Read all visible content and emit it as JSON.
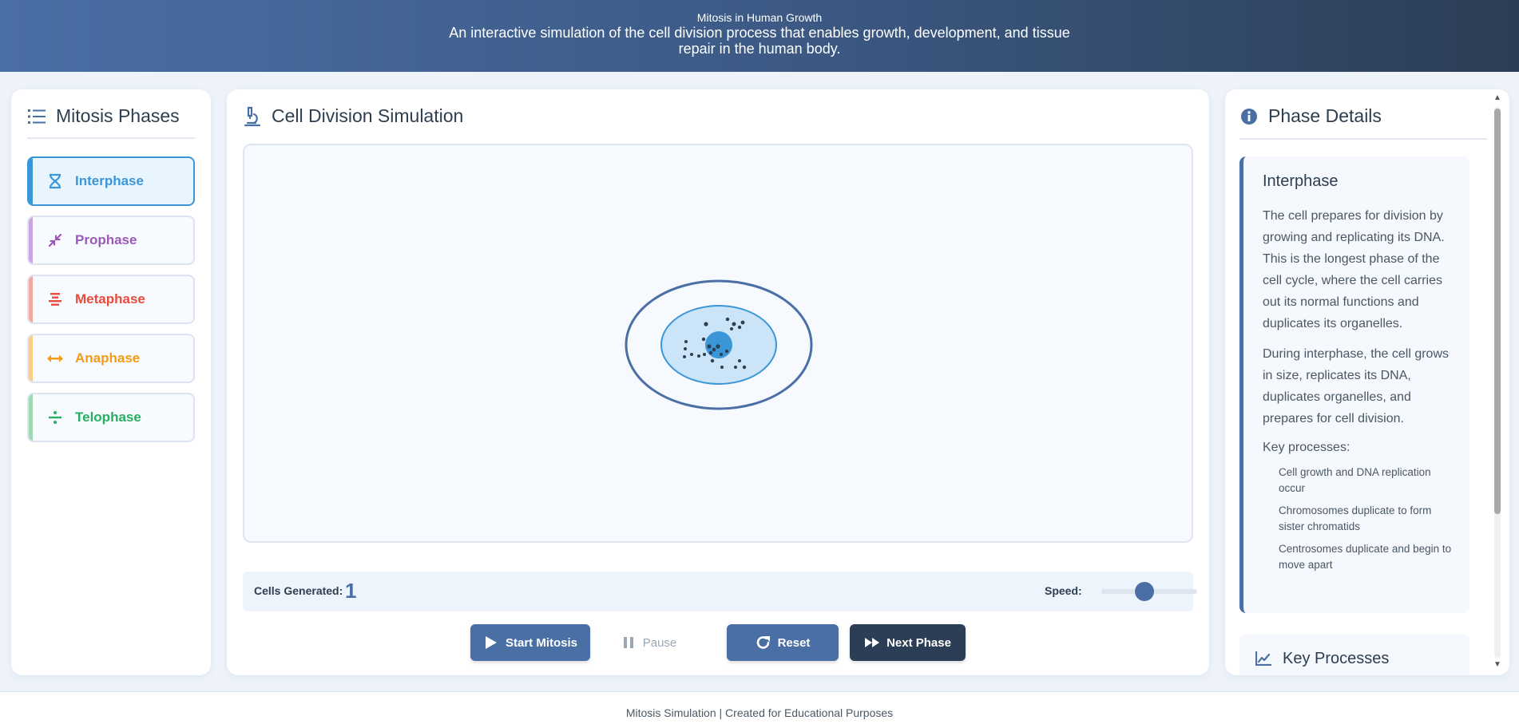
{
  "header": {
    "title": "Mitosis in Human Growth",
    "subtitle": "An interactive simulation of the cell division process that enables growth, development, and tissue repair in the human body."
  },
  "phases_panel": {
    "title": "Mitosis Phases",
    "icon": "list-icon",
    "items": [
      {
        "label": "Interphase",
        "icon": "dna-icon",
        "color": "#3b96d8",
        "active": true
      },
      {
        "label": "Prophase",
        "icon": "compress-icon",
        "color": "#9b59b6",
        "active": false
      },
      {
        "label": "Metaphase",
        "icon": "align-center-icon",
        "color": "#e74c3c",
        "active": false
      },
      {
        "label": "Anaphase",
        "icon": "arrows-horizontal-icon",
        "color": "#f39c12",
        "active": false
      },
      {
        "label": "Telophase",
        "icon": "divide-icon",
        "color": "#27ae60",
        "active": false
      }
    ]
  },
  "simulation": {
    "title": "Cell Division Simulation",
    "icon": "microscope-icon",
    "cells_label": "Cells Generated:",
    "cells_count": "1",
    "speed_label": "Speed:",
    "speed_level": 0.45
  },
  "controls": {
    "start_label": "Start Mitosis",
    "pause_label": "Pause",
    "reset_label": "Reset",
    "next_label": "Next Phase"
  },
  "details": {
    "title": "Phase Details",
    "icon": "info-icon",
    "phase_name": "Interphase",
    "paragraph1": "The cell prepares for division by growing and replicating its DNA. This is the longest phase of the cell cycle, where the cell carries out its normal functions and duplicates its organelles.",
    "paragraph2": "During interphase, the cell grows in size, replicates its DNA, duplicates organelles, and prepares for cell division.",
    "key_processes_label": "Key processes:",
    "key_processes": [
      "Cell growth and DNA replication occur",
      "Chromosomes duplicate to form sister chromatids",
      "Centrosomes duplicate and begin to move apart"
    ],
    "key_processes_card_title": "Key Processes"
  },
  "footer": {
    "text": "Mitosis Simulation | Created for Educational Purposes"
  },
  "colors": {
    "primary": "#4a6fa5",
    "dark": "#2c3e55",
    "accent": "#3b96d8"
  }
}
